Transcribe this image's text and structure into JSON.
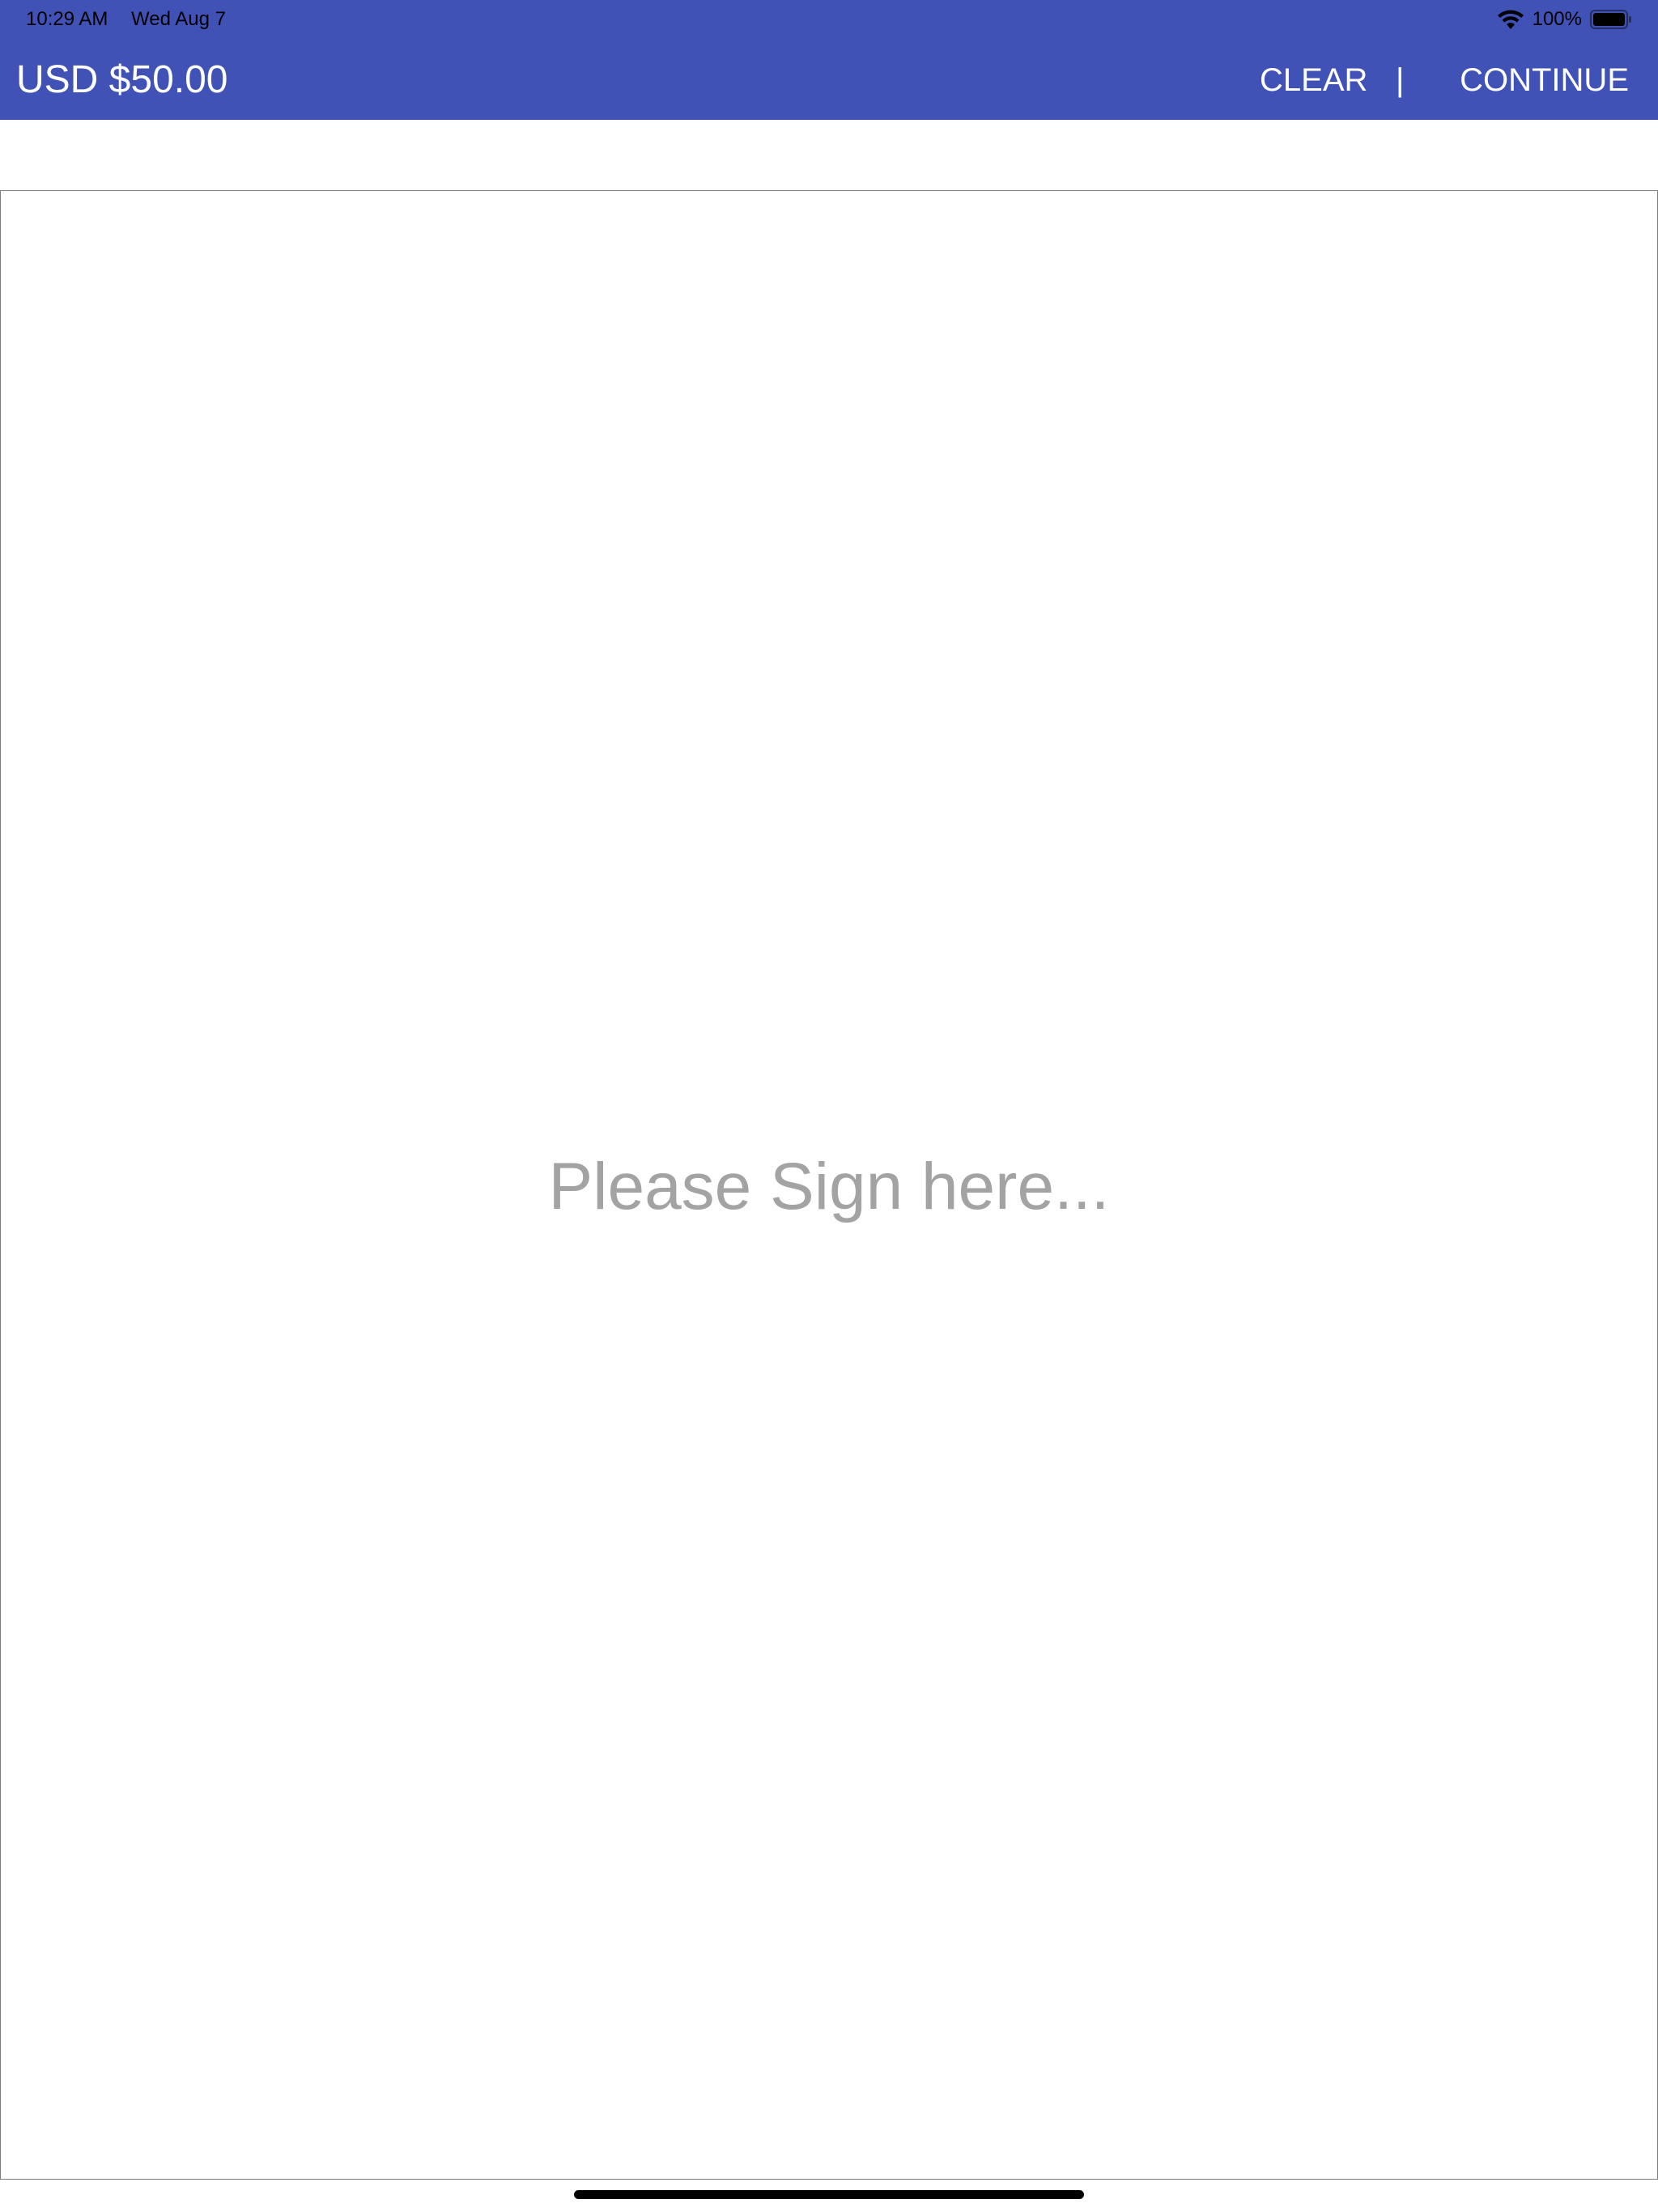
{
  "status_bar": {
    "time": "10:29 AM",
    "date": "Wed Aug 7",
    "battery_percent": "100%",
    "wifi_icon": "wifi-icon",
    "battery_icon": "battery-full-icon"
  },
  "header": {
    "amount": "USD $50.00",
    "clear_label": "CLEAR",
    "divider": "|",
    "continue_label": "CONTINUE",
    "background_color": "#4152b6"
  },
  "signature": {
    "placeholder": "Please Sign here..."
  }
}
